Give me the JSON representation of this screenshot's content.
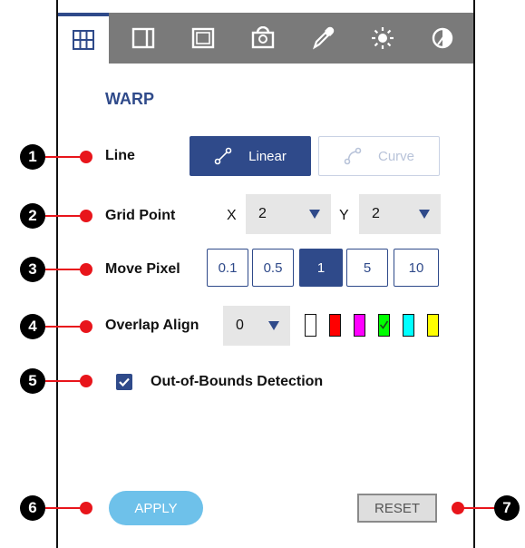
{
  "tabs": [
    {
      "icon": "grid-icon",
      "active": true
    },
    {
      "icon": "panel-left-icon",
      "active": false
    },
    {
      "icon": "frame-icon",
      "active": false
    },
    {
      "icon": "mask-icon",
      "active": false
    },
    {
      "icon": "color-picker-icon",
      "active": false
    },
    {
      "icon": "brightness-icon",
      "active": false
    },
    {
      "icon": "contrast-icon",
      "active": false
    }
  ],
  "section_title": "WARP",
  "line": {
    "label": "Line",
    "options": [
      {
        "label": "Linear",
        "icon": "linear-line-icon",
        "selected": true
      },
      {
        "label": "Curve",
        "icon": "curve-line-icon",
        "selected": false
      }
    ]
  },
  "grid_point": {
    "label": "Grid Point",
    "x_label": "X",
    "x_value": "2",
    "y_label": "Y",
    "y_value": "2"
  },
  "move_pixel": {
    "label": "Move Pixel",
    "steps": [
      "0.1",
      "0.5",
      "1",
      "5",
      "10"
    ],
    "selected": "1"
  },
  "overlap_align": {
    "label": "Overlap Align",
    "value": "0",
    "swatches": [
      {
        "color": "#ffffff",
        "checked": false
      },
      {
        "color": "#ff0000",
        "checked": false
      },
      {
        "color": "#ff00ff",
        "checked": false
      },
      {
        "color": "#00ff00",
        "checked": true
      },
      {
        "color": "#00ffff",
        "checked": false
      },
      {
        "color": "#ffff00",
        "checked": false
      }
    ]
  },
  "out_of_bounds": {
    "label": "Out-of-Bounds Detection",
    "checked": true
  },
  "buttons": {
    "apply": "APPLY",
    "reset": "RESET"
  },
  "callouts": [
    "1",
    "2",
    "3",
    "4",
    "5",
    "6",
    "7"
  ],
  "colors": {
    "accent": "#2f4a8a",
    "apply": "#6ec1ea",
    "callout_marker": "#e8151b",
    "tabbar": "#7a7a7a"
  }
}
